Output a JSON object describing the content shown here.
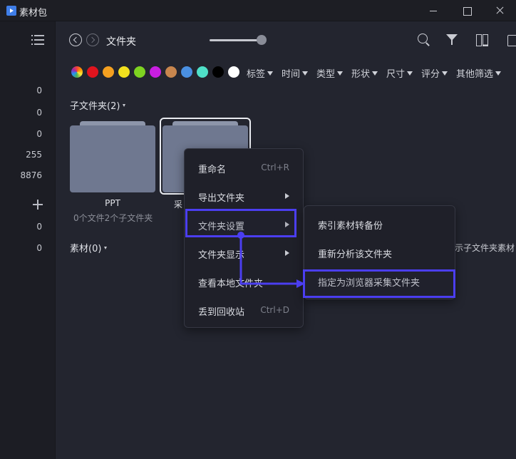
{
  "window": {
    "title": "素材包"
  },
  "sidebar": {
    "counts": [
      "0",
      "0",
      "0",
      "255",
      "8876",
      "0",
      "0"
    ]
  },
  "toolbar": {
    "breadcrumb": "文件夹",
    "zoom_slider_value": 0.9
  },
  "color_filters": [
    {
      "name": "all-colors",
      "color": "wheel"
    },
    {
      "name": "red",
      "color": "#e0141e"
    },
    {
      "name": "orange",
      "color": "#f4a020"
    },
    {
      "name": "yellow",
      "color": "#f2e01e"
    },
    {
      "name": "green",
      "color": "#7ed321"
    },
    {
      "name": "purple",
      "color": "#c81ee0"
    },
    {
      "name": "brown",
      "color": "#c8864e"
    },
    {
      "name": "blue",
      "color": "#4a90e2"
    },
    {
      "name": "teal",
      "color": "#4fe0c8"
    },
    {
      "name": "black",
      "color": "#000000"
    },
    {
      "name": "white",
      "color": "#ffffff"
    }
  ],
  "filters": [
    "标签",
    "时间",
    "类型",
    "形状",
    "尺寸",
    "评分",
    "其他筛选"
  ],
  "subfolders": {
    "label": "子文件夹(2)",
    "items": [
      {
        "name": "PPT",
        "meta": "0个文件2个子文件夹"
      },
      {
        "name": "采"
      }
    ]
  },
  "materials": {
    "label": "素材(0)",
    "partial_option": "示子文件夹素材"
  },
  "context_menu": {
    "items": [
      {
        "label": "重命名",
        "shortcut": "Ctrl+R"
      },
      {
        "label": "导出文件夹",
        "submenu": true
      },
      {
        "label": "文件夹设置",
        "submenu": true,
        "highlighted": true
      },
      {
        "label": "文件夹显示",
        "submenu": true
      },
      {
        "label": "查看本地文件夹"
      },
      {
        "label": "丢到回收站",
        "shortcut": "Ctrl+D"
      }
    ]
  },
  "submenu": {
    "items": [
      {
        "label": "索引素材转备份"
      },
      {
        "label": "重新分析该文件夹"
      },
      {
        "label": "指定为浏览器采集文件夹",
        "highlighted": true
      }
    ]
  },
  "accent_color": "#4b3ef0"
}
